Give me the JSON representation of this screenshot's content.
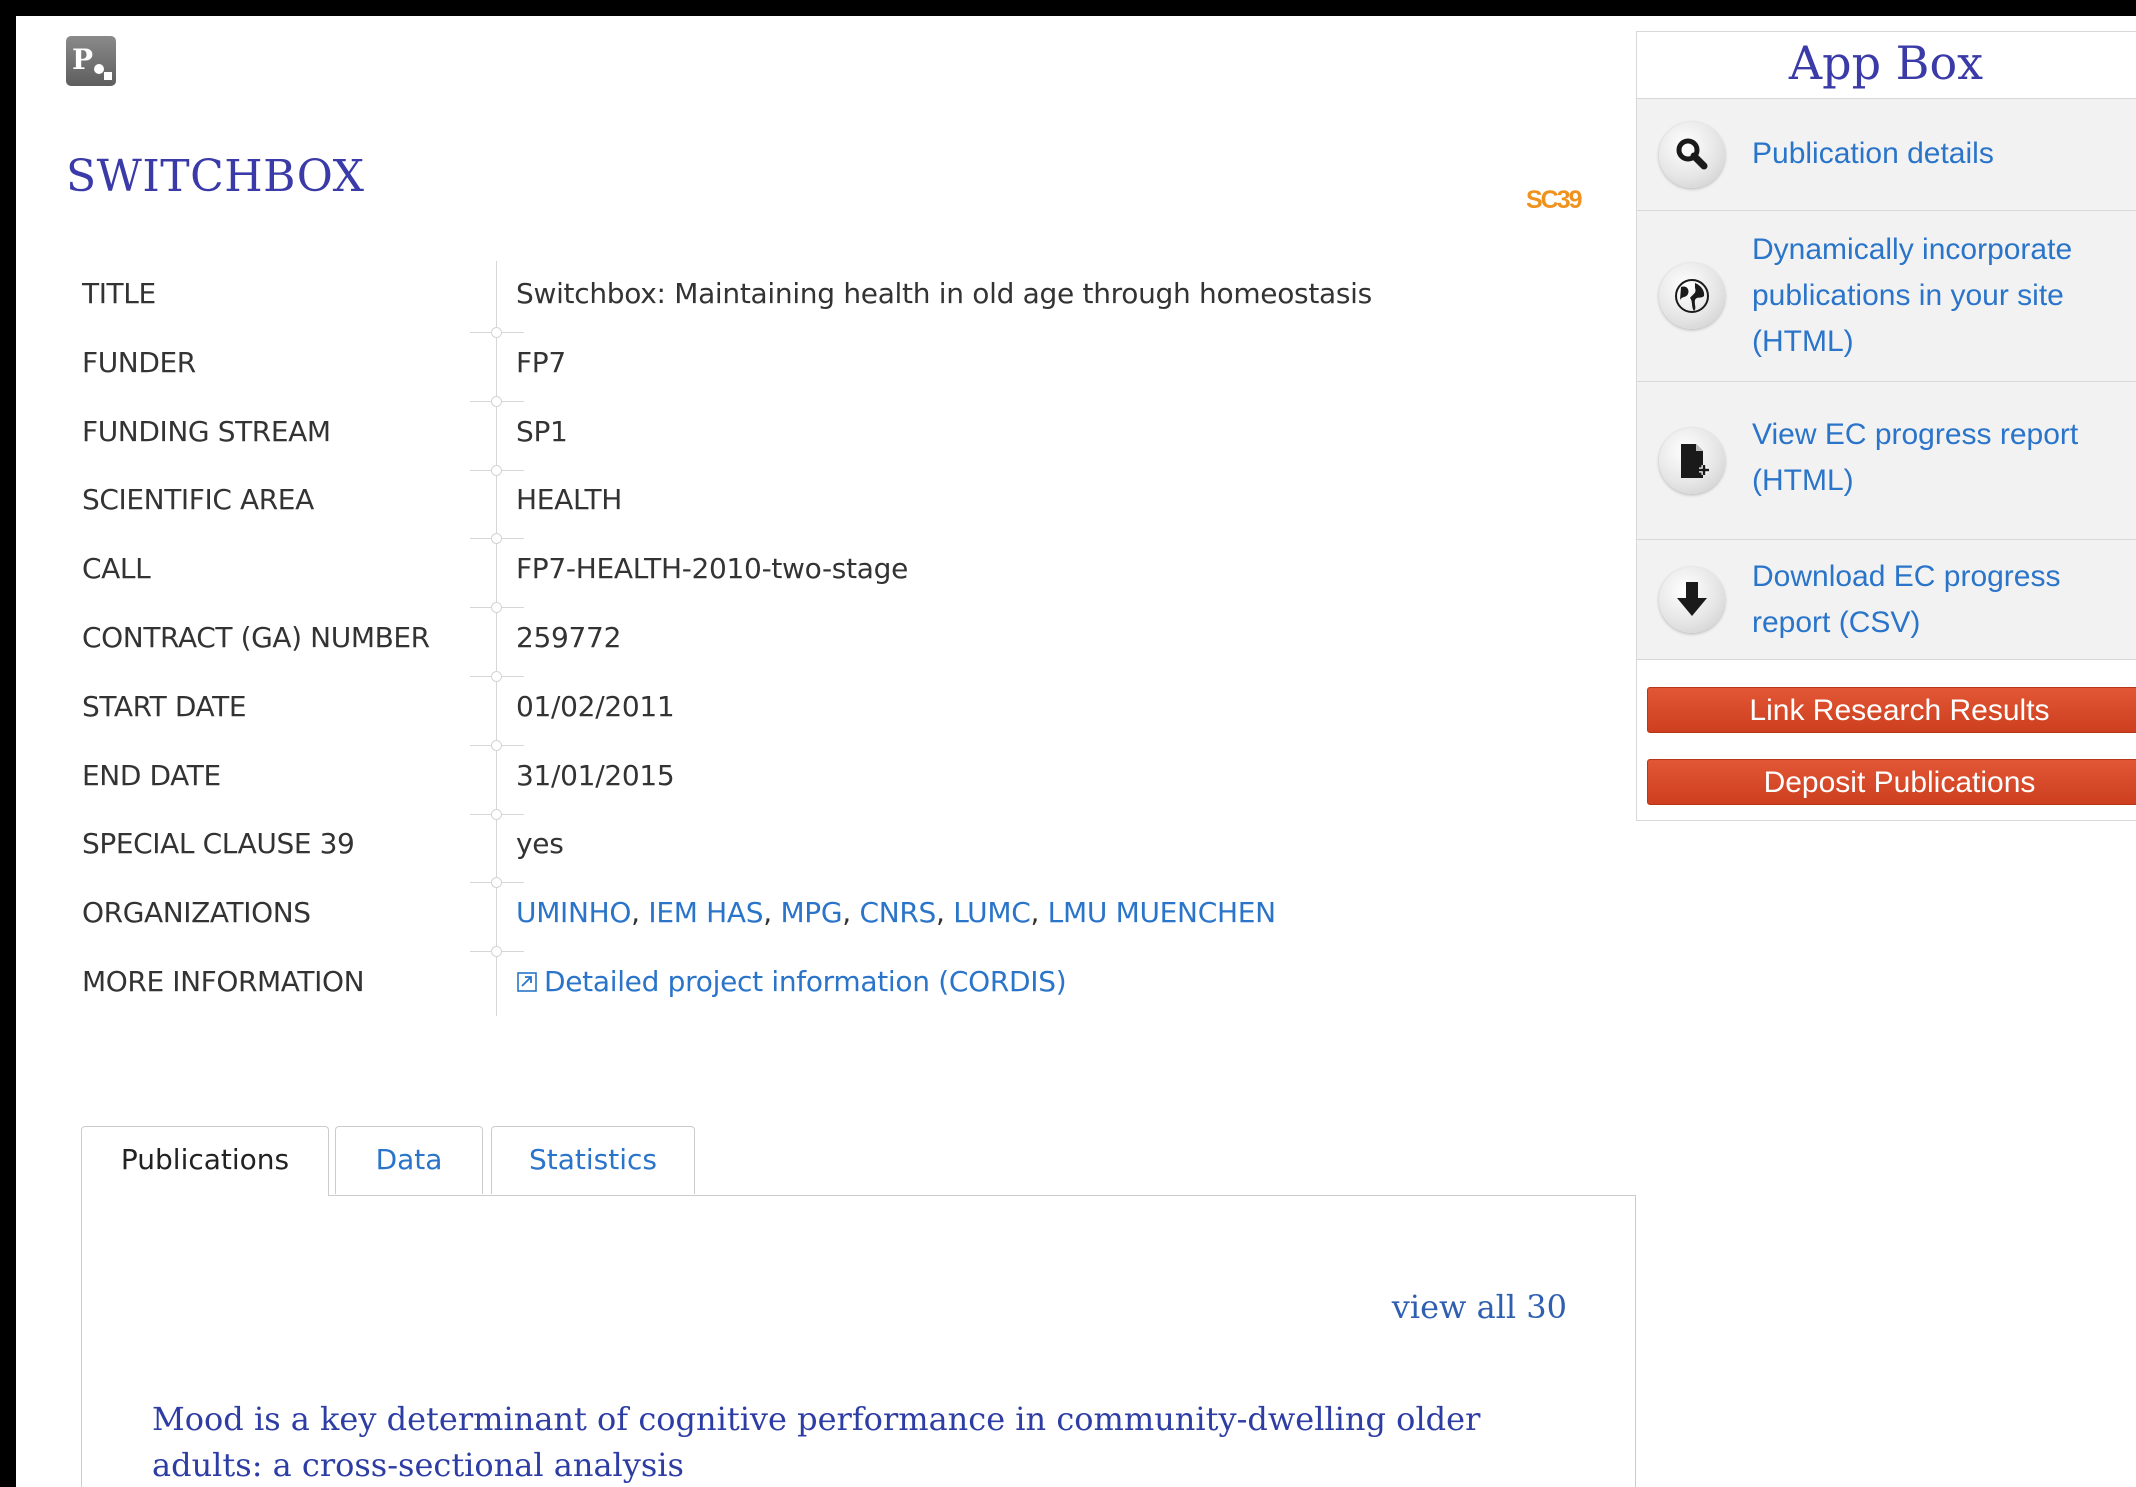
{
  "project": {
    "name": "SWITCHBOX",
    "badge": "SC39"
  },
  "details": [
    {
      "label": "TITLE",
      "value": "Switchbox: Maintaining health in old age through homeostasis"
    },
    {
      "label": "FUNDER",
      "value": "FP7"
    },
    {
      "label": "FUNDING STREAM",
      "value": "SP1"
    },
    {
      "label": "SCIENTIFIC AREA",
      "value": "HEALTH"
    },
    {
      "label": "CALL",
      "value": "FP7-HEALTH-2010-two-stage"
    },
    {
      "label": "CONTRACT (GA) NUMBER",
      "value": "259772"
    },
    {
      "label": "START DATE",
      "value": "01/02/2011"
    },
    {
      "label": "END DATE",
      "value": "31/01/2015"
    },
    {
      "label": "SPECIAL CLAUSE 39",
      "value": "yes"
    },
    {
      "label": "ORGANIZATIONS",
      "organizations": [
        "UMINHO",
        "IEM HAS",
        "MPG",
        "CNRS",
        "LUMC",
        "LMU MUENCHEN"
      ],
      "separator": ", "
    },
    {
      "label": "MORE INFORMATION",
      "link_text": "Detailed project information (CORDIS)",
      "link_icon": "external-link-icon"
    }
  ],
  "tabs": [
    {
      "label": "Publications",
      "active": true
    },
    {
      "label": "Data",
      "active": false
    },
    {
      "label": "Statistics",
      "active": false
    }
  ],
  "publications_panel": {
    "view_all": "view all 30",
    "first_publication": "Mood is a key determinant of cognitive performance in community-dwelling older adults: a cross-sectional analysis"
  },
  "appbox": {
    "title": "App Box",
    "items": [
      {
        "label": "Publication details",
        "icon": "magnifier-icon"
      },
      {
        "label": "Dynamically incorporate publications in your site (HTML)",
        "icon": "globe-icon"
      },
      {
        "label": "View EC progress report (HTML)",
        "icon": "document-add-icon"
      },
      {
        "label": "Download EC progress report (CSV)",
        "icon": "download-arrow-icon"
      }
    ],
    "buttons": {
      "link_results": "Link Research Results",
      "deposit": "Deposit Publications"
    }
  },
  "colors": {
    "title_blue": "#3a3aa8",
    "link_blue": "#2a74c9",
    "badge_orange": "#f0931e",
    "button_red": "#d84a28"
  }
}
